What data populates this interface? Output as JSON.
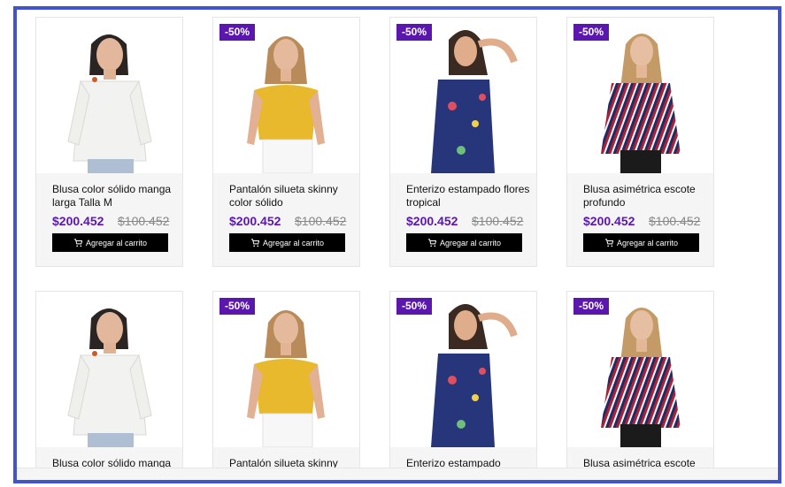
{
  "products": [
    {
      "badge": "",
      "name": "Blusa color sólido manga larga Talla M",
      "price": "$200.452",
      "old_price": "$100.452",
      "button": "Agregar al carrito",
      "image": "lace-blouse"
    },
    {
      "badge": "-50%",
      "name": "Pantalón silueta skinny color sólido",
      "price": "$200.452",
      "old_price": "$100.452",
      "button": "Agregar al carrito",
      "image": "yellow-top"
    },
    {
      "badge": "-50%",
      "name": "Enterizo estampado flores tropical",
      "price": "$200.452",
      "old_price": "$100.452",
      "button": "Agregar al carrito",
      "image": "floral-jumpsuit"
    },
    {
      "badge": "-50%",
      "name": "Blusa asimétrica escote profundo",
      "price": "$200.452",
      "old_price": "$100.452",
      "button": "Agregar al carrito",
      "image": "striped-blouse"
    },
    {
      "badge": "",
      "name": "Blusa color sólido manga",
      "price": "",
      "old_price": "",
      "button": "",
      "image": "lace-blouse"
    },
    {
      "badge": "-50%",
      "name": "Pantalón silueta skinny",
      "price": "",
      "old_price": "",
      "button": "",
      "image": "yellow-top"
    },
    {
      "badge": "-50%",
      "name": "Enterizo estampado",
      "price": "",
      "old_price": "",
      "button": "",
      "image": "floral-jumpsuit"
    },
    {
      "badge": "-50%",
      "name": "Blusa asimétrica escote",
      "price": "",
      "old_price": "",
      "button": "",
      "image": "striped-blouse"
    }
  ],
  "colors": {
    "accent": "#5b16ad",
    "frame": "#4353cc",
    "button": "#000000"
  }
}
